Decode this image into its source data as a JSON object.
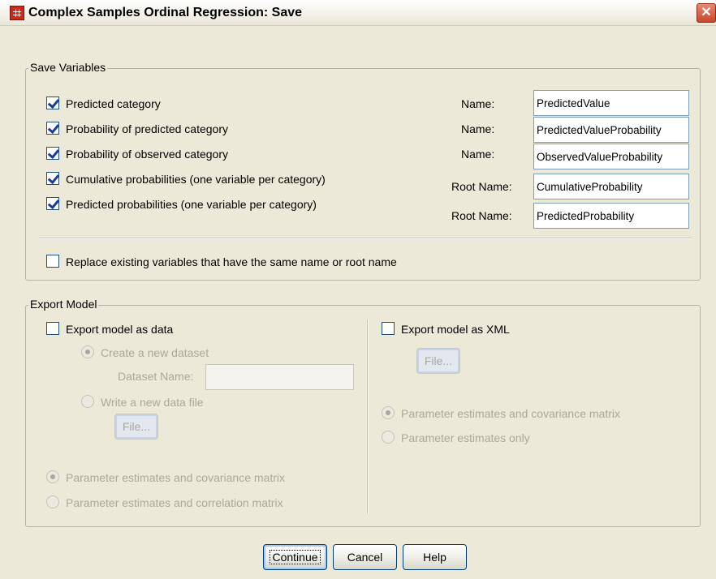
{
  "window": {
    "title": "Complex Samples Ordinal Regression: Save",
    "close_glyph": "✕"
  },
  "save_variables": {
    "legend": "Save Variables",
    "items": [
      {
        "label": "Predicted category",
        "checked": true,
        "name_label": "Name:",
        "value": "PredictedValue"
      },
      {
        "label": "Probability of predicted category",
        "checked": true,
        "name_label": "Name:",
        "value": "PredictedValueProbability"
      },
      {
        "label": "Probability of observed category",
        "checked": true,
        "name_label": "Name:",
        "value": "ObservedValueProbability"
      },
      {
        "label": "Cumulative probabilities (one variable per category)",
        "checked": true,
        "name_label": "Root Name:",
        "value": "CumulativeProbability"
      },
      {
        "label": "Predicted probabilities (one variable per category)",
        "checked": true,
        "name_label": "Root Name:",
        "value": "PredictedProbability"
      }
    ],
    "replace_label": "Replace existing variables that have the same name or root name",
    "replace_checked": false
  },
  "export_model": {
    "legend": "Export Model",
    "as_data": {
      "label": "Export model as data",
      "checked": false,
      "create_new_label": "Create a new dataset",
      "dataset_name_label": "Dataset Name:",
      "dataset_name_value": "",
      "write_file_label": "Write a new data file",
      "file_button": "File...",
      "param_cov_label": "Parameter estimates and covariance matrix",
      "param_corr_label": "Parameter estimates and correlation matrix"
    },
    "as_xml": {
      "label": "Export model as XML",
      "checked": false,
      "file_button": "File...",
      "param_cov_label": "Parameter estimates and covariance matrix",
      "param_only_label": "Parameter estimates only"
    }
  },
  "buttons": {
    "continue": "Continue",
    "cancel": "Cancel",
    "help": "Help"
  }
}
